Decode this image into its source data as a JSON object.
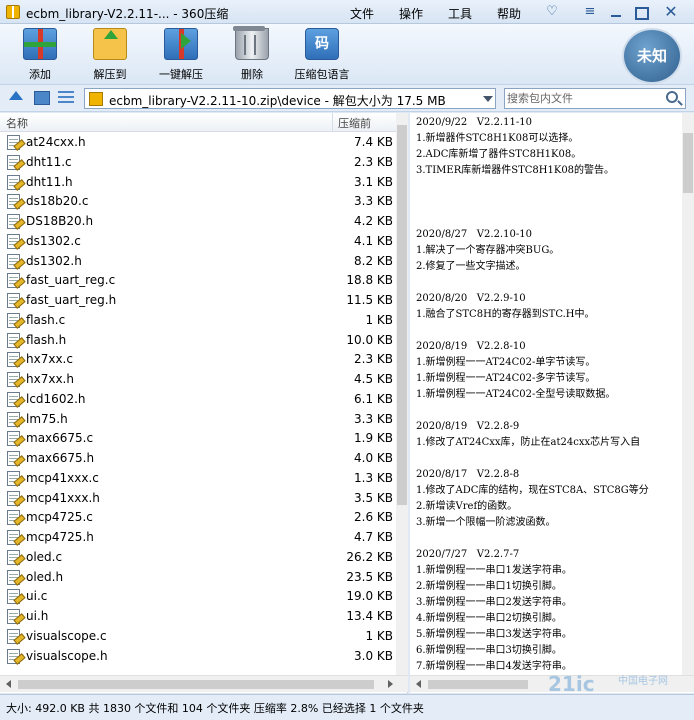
{
  "window": {
    "title": "ecbm_library-V2.2.11-... - 360压缩",
    "menu": [
      "文件",
      "操作",
      "工具",
      "帮助"
    ]
  },
  "toolbar": {
    "add": "添加",
    "extract_to": "解压到",
    "one_click_extract": "一键解压",
    "delete": "删除",
    "code_icon_glyph": "码",
    "compress_language": "压缩包语言"
  },
  "security_badge": "未知",
  "address": {
    "path": "ecbm_library-V2.2.11-10.zip\\device - 解包大小为 17.5 MB",
    "search_placeholder": "搜索包内文件"
  },
  "file_list": {
    "col_name": "名称",
    "col_size": "压缩前",
    "files": [
      {
        "name": "at24cxx.h",
        "size": "7.4 KB"
      },
      {
        "name": "dht11.c",
        "size": "2.3 KB"
      },
      {
        "name": "dht11.h",
        "size": "3.1 KB"
      },
      {
        "name": "ds18b20.c",
        "size": "3.3 KB"
      },
      {
        "name": "DS18B20.h",
        "size": "4.2 KB"
      },
      {
        "name": "ds1302.c",
        "size": "4.1 KB"
      },
      {
        "name": "ds1302.h",
        "size": "8.2 KB"
      },
      {
        "name": "fast_uart_reg.c",
        "size": "18.8 KB"
      },
      {
        "name": "fast_uart_reg.h",
        "size": "11.5 KB"
      },
      {
        "name": "flash.c",
        "size": "1 KB"
      },
      {
        "name": "flash.h",
        "size": "10.0 KB"
      },
      {
        "name": "hx7xx.c",
        "size": "2.3 KB"
      },
      {
        "name": "hx7xx.h",
        "size": "4.5 KB"
      },
      {
        "name": "lcd1602.h",
        "size": "6.1 KB"
      },
      {
        "name": "lm75.h",
        "size": "3.3 KB"
      },
      {
        "name": "max6675.c",
        "size": "1.9 KB"
      },
      {
        "name": "max6675.h",
        "size": "4.0 KB"
      },
      {
        "name": "mcp41xxx.c",
        "size": "1.3 KB"
      },
      {
        "name": "mcp41xxx.h",
        "size": "3.5 KB"
      },
      {
        "name": "mcp4725.c",
        "size": "2.6 KB"
      },
      {
        "name": "mcp4725.h",
        "size": "4.7 KB"
      },
      {
        "name": "oled.c",
        "size": "26.2 KB"
      },
      {
        "name": "oled.h",
        "size": "23.5 KB"
      },
      {
        "name": "ui.c",
        "size": "19.0 KB"
      },
      {
        "name": "ui.h",
        "size": "13.4 KB"
      },
      {
        "name": "visualscope.c",
        "size": "1 KB"
      },
      {
        "name": "visualscope.h",
        "size": "3.0 KB"
      }
    ]
  },
  "preview": {
    "lines": [
      "2020/9/22   V2.2.11-10",
      "1.新增器件STC8H1K08可以选择。",
      "2.ADC库新增了器件STC8H1K08。",
      "3.TIMER库新增器件STC8H1K08的警告。",
      "",
      "",
      "",
      "2020/8/27   V2.2.10-10",
      "1.解决了一个寄存器冲突BUG。",
      "2.修复了一些文字描述。",
      "",
      "2020/8/20   V2.2.9-10",
      "1.融合了STC8H的寄存器到STC.H中。",
      "",
      "2020/8/19   V2.2.8-10",
      "1.新增例程一一AT24C02-单字节读写。",
      "1.新增例程一一AT24C02-多字节读写。",
      "1.新增例程一一AT24C02-全型号读取数据。",
      "",
      "2020/8/19   V2.2.8-9",
      "1.修改了AT24Cxx库，防止在at24cxx芯片写入自",
      "",
      "2020/8/17   V2.2.8-8",
      "1.修改了ADC库的结构，现在STC8A、STC8G等分",
      "2.新增读Vref的函数。",
      "3.新增一个限幅一阶滤波函数。",
      "",
      "2020/7/27   V2.2.7-7",
      "1.新增例程一一串口1发送字符串。",
      "2.新增例程一一串口1切换引脚。",
      "3.新增例程一一串口2发送字符串。",
      "4.新增例程一一串口2切换引脚。",
      "5.新增例程一一串口3发送字符串。",
      "6.新增例程一一串口3切换引脚。",
      "7.新增例程一一串口4发送字符串。",
      "8.新增例程一一串口4切换引脚。"
    ]
  },
  "watermark": {
    "main": "21ic",
    "sub": "中国电子网"
  },
  "status": "大小: 492.0 KB 共 1830 个文件和 104 个文件夹 压缩率 2.8% 已经选择 1 个文件夹"
}
